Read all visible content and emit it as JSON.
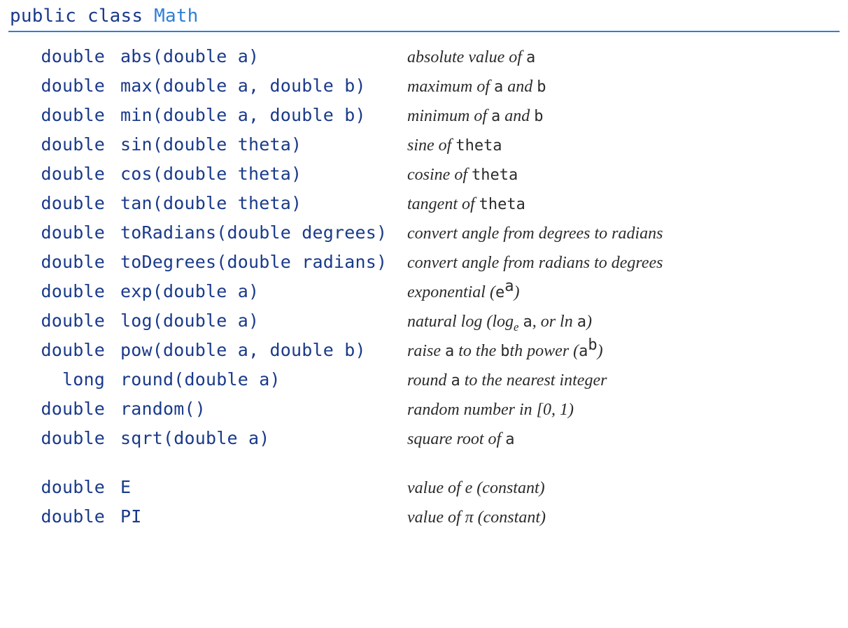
{
  "header": {
    "keywords": "public class ",
    "classname": "Math"
  },
  "rows": [
    {
      "ret": "double",
      "sig": "abs(double a)",
      "desc_pre": "absolute value of ",
      "desc_tt": "a",
      "desc_post": ""
    },
    {
      "ret": "double",
      "sig": "max(double a, double b)",
      "desc_pre": "maximum of ",
      "desc_tt": "a",
      "desc_mid": " and ",
      "desc_tt2": "b",
      "desc_post": ""
    },
    {
      "ret": "double",
      "sig": "min(double a, double b)",
      "desc_pre": "minimum of ",
      "desc_tt": "a",
      "desc_mid": " and ",
      "desc_tt2": "b",
      "desc_post": ""
    },
    {
      "ret": "double",
      "sig": "sin(double theta)",
      "desc_pre": "sine of ",
      "desc_tt": "theta",
      "desc_post": ""
    },
    {
      "ret": "double",
      "sig": "cos(double theta)",
      "desc_pre": "cosine of ",
      "desc_tt": "theta",
      "desc_post": ""
    },
    {
      "ret": "double",
      "sig": "tan(double theta)",
      "desc_pre": "tangent of ",
      "desc_tt": "theta",
      "desc_post": ""
    },
    {
      "ret": "double",
      "sig": "toRadians(double degrees)",
      "desc_pre": "convert angle from degrees to radians"
    },
    {
      "ret": "double",
      "sig": "toDegrees(double radians)",
      "desc_pre": "convert angle from radians to degrees"
    },
    {
      "ret": "double",
      "sig": "exp(double a)",
      "desc_pre": "exponential (",
      "desc_tt": "e",
      "desc_sup_tt": "a",
      "desc_post": ")"
    },
    {
      "ret": "double",
      "sig": "log(double a)",
      "desc_pre": "natural log (log",
      "desc_sub": "e",
      "desc_mid": " ",
      "desc_tt": "a",
      "desc_mid2": ", or ln ",
      "desc_tt2": "a",
      "desc_post": ")"
    },
    {
      "ret": "double",
      "sig": "pow(double a, double b)",
      "desc_pre": "raise ",
      "desc_tt": "a",
      "desc_mid": " to the ",
      "desc_tt2": "b",
      "desc_mid2": "th power (",
      "desc_tt3": "a",
      "desc_sup_tt": "b",
      "desc_post": ")"
    },
    {
      "ret": "long",
      "sig": "round(double a)",
      "desc_pre": "round ",
      "desc_tt": "a",
      "desc_post": "  to the nearest integer"
    },
    {
      "ret": "double",
      "sig": "random()",
      "desc_pre": "random number in [0, 1)"
    },
    {
      "ret": "double",
      "sig": "sqrt(double a)",
      "desc_pre": "square root of ",
      "desc_tt": "a",
      "desc_post": ""
    },
    {
      "spacer": true
    },
    {
      "ret": "double",
      "sig": "E",
      "desc_pre": "value of e (constant)"
    },
    {
      "ret": "double",
      "sig": "PI",
      "desc_pre": "value of π (constant)"
    }
  ]
}
